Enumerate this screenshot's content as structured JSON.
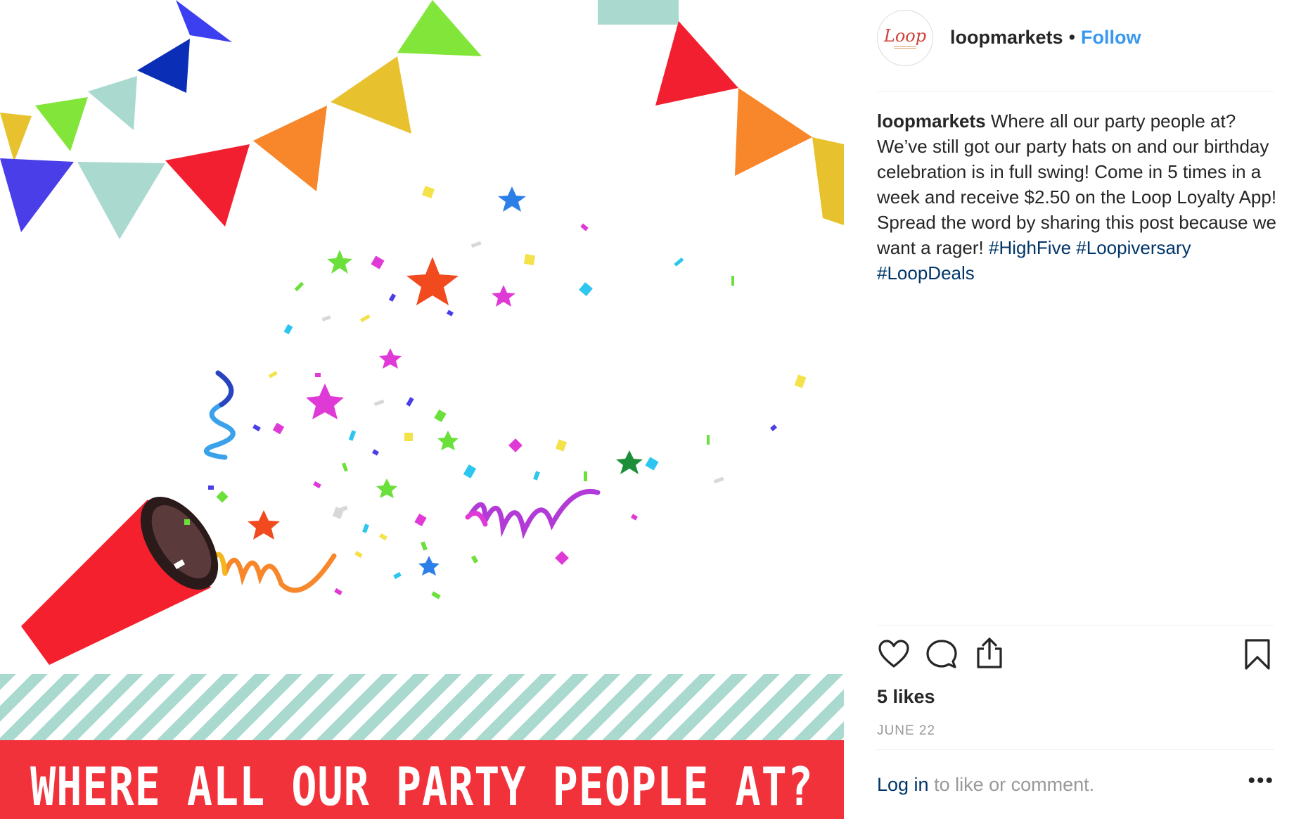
{
  "post": {
    "banner_text": "WHERE ALL OUR PARTY PEOPLE AT?",
    "colors": {
      "banner_red": "#f2323a",
      "stripe_teal": "#a9d9cf",
      "popper_red": "#f5202e"
    }
  },
  "header": {
    "avatar_text": "Loop",
    "username": "loopmarkets",
    "separator": "•",
    "follow_label": "Follow"
  },
  "caption": {
    "username": "loopmarkets",
    "text": "Where all our party people at? We’ve still got our party hats on and our birthday celebration is in full swing! Come in 5 times in a week and receive $2.50 on the Loop Loyalty App! Spread the word by sharing this post because we want a rager!",
    "hashtags": [
      "#HighFive",
      "#Loopiversary",
      "#LoopDeals"
    ]
  },
  "actions": {
    "icons": [
      "heart-icon",
      "comment-icon",
      "share-icon",
      "bookmark-icon"
    ]
  },
  "likes_text": "5 likes",
  "date_text": "JUNE 22",
  "footer": {
    "login_label": "Log in",
    "prompt_text": "to like or comment.",
    "more_label": "•••"
  },
  "theme": {
    "link_blue": "#3897f0",
    "hashtag_blue": "#003569",
    "muted_gray": "#999999",
    "text_dark": "#262626"
  }
}
